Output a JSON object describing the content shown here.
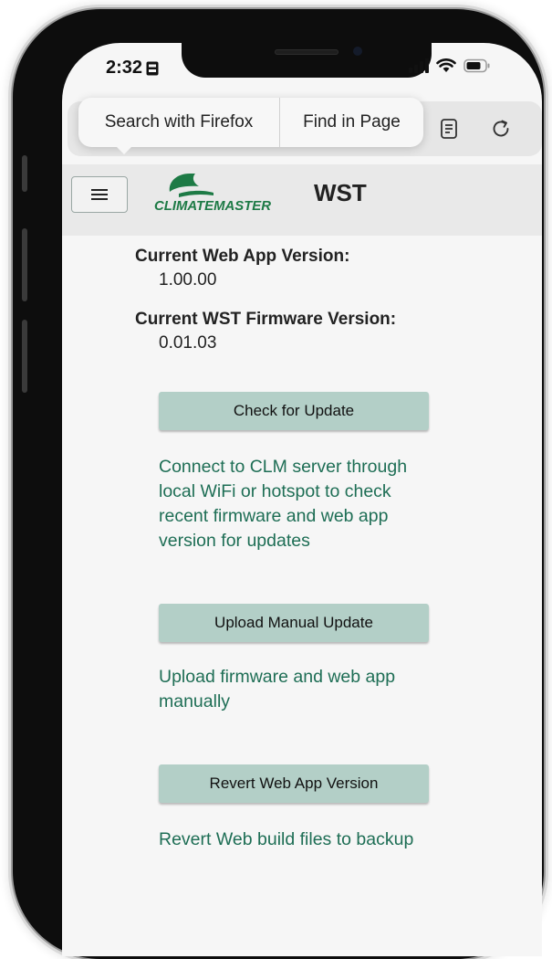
{
  "status_bar": {
    "time": "2:32"
  },
  "browser": {
    "popup": {
      "search_label": "Search with Firefox",
      "find_label": "Find in Page"
    },
    "icons": [
      "reader-view-icon",
      "reload-icon"
    ]
  },
  "app": {
    "brand": "CLIMATEMASTER",
    "title": "WST"
  },
  "versions": {
    "web_app_label": "Current Web App Version:",
    "web_app_value": "1.00.00",
    "firmware_label": "Current WST Firmware Version:",
    "firmware_value": "0.01.03"
  },
  "actions": [
    {
      "button_label": "Check for Update",
      "description": "Connect to CLM server through local WiFi or hotspot to check recent firmware and web app version for updates"
    },
    {
      "button_label": "Upload Manual Update",
      "description": "Upload firmware and web app manually"
    },
    {
      "button_label": "Revert Web App Version",
      "description": "Revert Web build files to backup"
    }
  ],
  "colors": {
    "button_bg": "#b3cfc7",
    "description_text": "#1e6e55",
    "brand_green": "#1d7a45"
  }
}
